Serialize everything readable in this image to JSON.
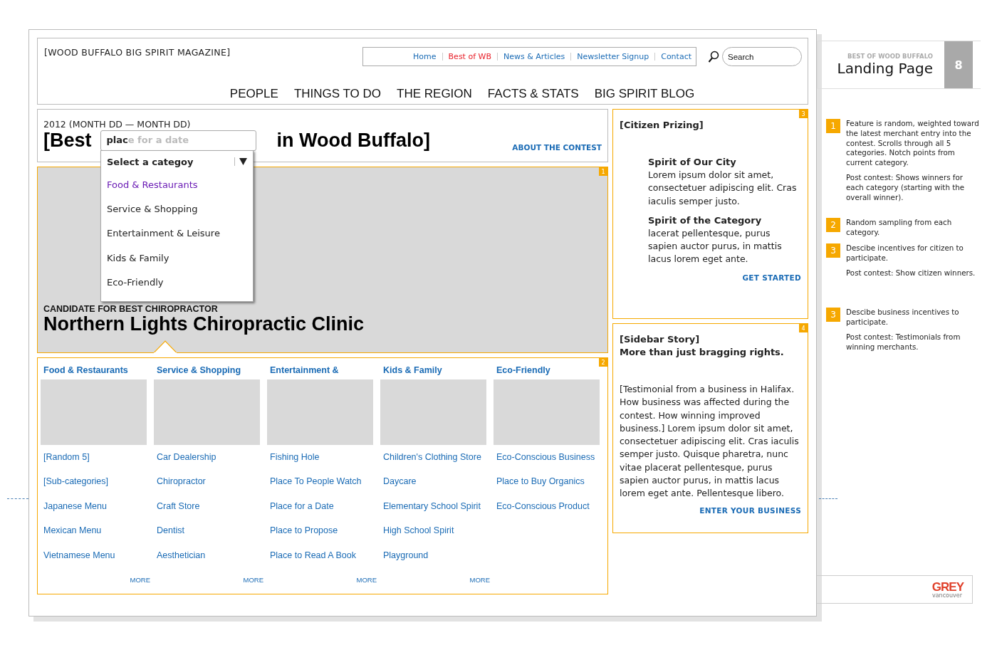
{
  "header": {
    "site_title": "[WOOD BUFFALO BIG SPIRIT MAGAZINE]",
    "top_links": [
      {
        "label": "Home",
        "selected": false
      },
      {
        "label": "Best of WB",
        "selected": true
      },
      {
        "label": "News & Articles",
        "selected": false
      },
      {
        "label": "Newsletter Signup",
        "selected": false
      },
      {
        "label": "Contact",
        "selected": false
      }
    ],
    "search": {
      "placeholder": "Search"
    },
    "main_nav": [
      "PEOPLE",
      "THINGS TO DO",
      "THE REGION",
      "FACTS & STATS",
      "BIG SPIRIT BLOG"
    ]
  },
  "contest": {
    "dates": "2012 (MONTH DD — MONTH DD)",
    "title_start": "[Best",
    "title_end": "in Wood Buffalo]",
    "field": {
      "value": "plac",
      "suggestion": "e for a date"
    },
    "about_link": "ABOUT THE CONTEST",
    "dropdown": {
      "header": "Select a categoy",
      "items": [
        {
          "label": "Food & Restaurants",
          "selected": true
        },
        {
          "label": "Service & Shopping",
          "selected": false
        },
        {
          "label": "Entertainment & Leisure",
          "selected": false
        },
        {
          "label": "Kids & Family",
          "selected": false
        },
        {
          "label": "Eco-Friendly",
          "selected": false
        }
      ]
    }
  },
  "feature": {
    "badge": "1",
    "kicker": "CANDIDATE FOR BEST CHIROPRACTOR",
    "name": "Northern Lights Chiropractic Clinic"
  },
  "categories": {
    "badge": "2",
    "columns": [
      {
        "heading": "Food & Restaurants",
        "links": [
          "[Random 5]",
          "[Sub-categories]",
          "Japanese Menu",
          "Mexican Menu",
          "Vietnamese Menu"
        ],
        "more": "MORE"
      },
      {
        "heading": "Service & Shopping",
        "links": [
          "Car Dealership",
          "Chiropractor",
          "Craft Store",
          "Dentist",
          "Aesthetician"
        ],
        "more": "MORE"
      },
      {
        "heading": "Entertainment &",
        "links": [
          "Fishing Hole",
          "Place To People Watch",
          "Place for a Date",
          "Place to Propose",
          "Place to Read A Book"
        ],
        "more": "MORE"
      },
      {
        "heading": "Kids & Family",
        "links": [
          "Children's Clothing Store",
          "Daycare",
          "Elementary School Spirit",
          "High School Spirit",
          "Playground"
        ],
        "more": "MORE"
      },
      {
        "heading": "Eco-Friendly",
        "links": [
          "Eco-Conscious Business",
          "Place to Buy Organics",
          "Eco-Conscious Product"
        ]
      }
    ]
  },
  "citizen": {
    "badge": "3",
    "title": "[Citizen Prizing]",
    "sections": [
      {
        "heading": "Spirit of Our City",
        "body": "Lorem ipsum dolor sit amet, consectetuer adipiscing elit. Cras iaculis semper justo."
      },
      {
        "heading": "Spirit of the Category",
        "body": "lacerat pellentesque, purus sapien auctor purus, in mattis lacus lorem eget ante."
      }
    ],
    "link": "GET STARTED"
  },
  "sidebar_story": {
    "badge": "4",
    "title": "[Sidebar Story]",
    "subtitle": "More than just bragging rights.",
    "body": "[Testimonial from a business in Halifax. How business was affected during the contest. How winning improved business.] Lorem ipsum dolor sit amet, consectetuer adipiscing elit. Cras iaculis semper justo. Quisque pharetra, nunc vitae placerat pellentesque, purus sapien auctor purus, in mattis lacus lorem eget ante. Pellentesque libero.",
    "link": "ENTER YOUR BUSINESS"
  },
  "annotations": {
    "kicker": "BEST OF WOOD BUFFALO",
    "title": "Landing Page",
    "page_number": "8",
    "notes": [
      {
        "number": "1",
        "paragraphs": [
          "Feature is random, weighted toward the latest merchant entry into the contest. Scrolls through all 5 categories. Notch points from current category.",
          "Post contest: Shows winners for each category (starting with the overall winner)."
        ]
      },
      {
        "number": "2",
        "paragraphs": [
          "Random sampling from each category."
        ]
      },
      {
        "number": "3",
        "paragraphs": [
          "Descibe incentives for citizen to participate.",
          "Post contest: Show citizen winners."
        ]
      },
      {
        "number": "3",
        "paragraphs": [
          "Descibe business incentives to participate.",
          "Post contest: Testimonials from winning merchants."
        ]
      }
    ],
    "logo": {
      "text": "GREY",
      "subtext": "vancouver"
    }
  }
}
